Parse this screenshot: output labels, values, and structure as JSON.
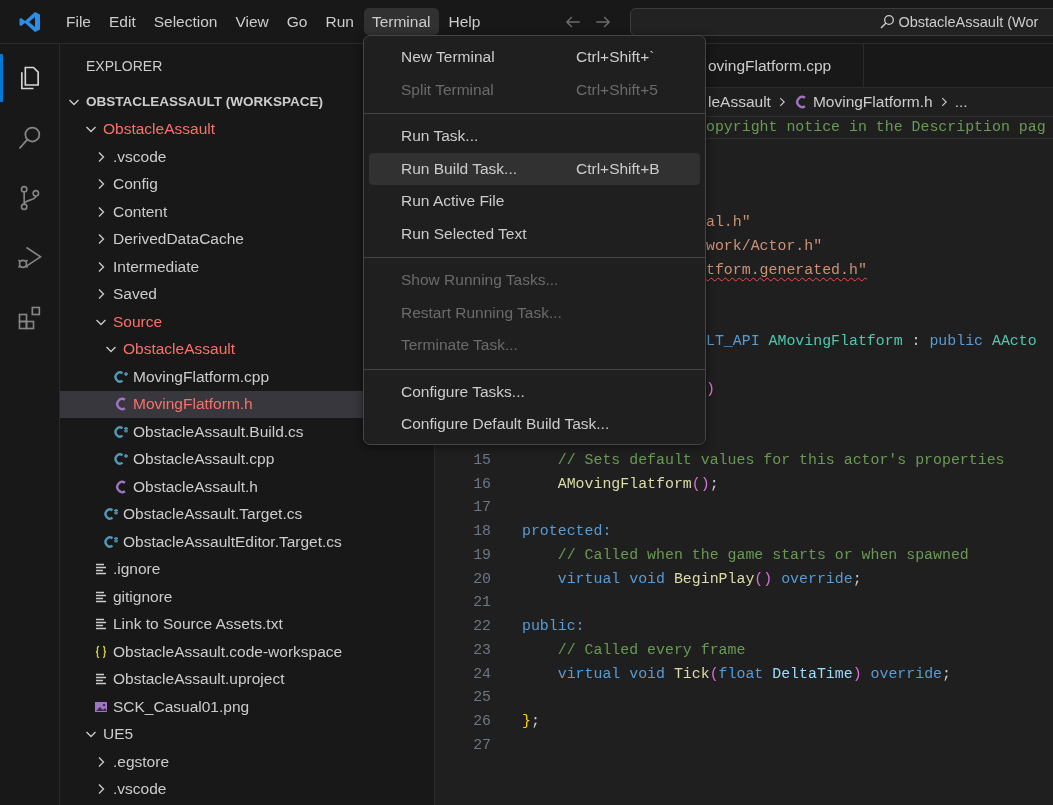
{
  "menubar": [
    {
      "label": "File",
      "selected": false
    },
    {
      "label": "Edit",
      "selected": false
    },
    {
      "label": "Selection",
      "selected": false
    },
    {
      "label": "View",
      "selected": false
    },
    {
      "label": "Go",
      "selected": false
    },
    {
      "label": "Run",
      "selected": false
    },
    {
      "label": "Terminal",
      "selected": true
    },
    {
      "label": "Help",
      "selected": false
    }
  ],
  "command_center": {
    "text": "ObstacleAssault (Wor"
  },
  "activity_bar": [
    {
      "kind": "explorer",
      "selected": true
    },
    {
      "kind": "search",
      "selected": false
    },
    {
      "kind": "source-control",
      "selected": false
    },
    {
      "kind": "run-debug",
      "selected": false
    },
    {
      "kind": "extensions",
      "selected": false
    }
  ],
  "sidebar": {
    "title": "EXPLORER",
    "tree": [
      {
        "label": "OBSTACLEASSAULT (WORKSPACE)",
        "kind": "root",
        "expanded": true,
        "selected": false,
        "error": false,
        "children": [
          {
            "label": "ObstacleAssault",
            "kind": "folder",
            "expanded": true,
            "selected": false,
            "error": true,
            "children": [
              {
                "label": ".vscode",
                "kind": "folder",
                "expanded": false,
                "selected": false,
                "error": false
              },
              {
                "label": "Config",
                "kind": "folder",
                "expanded": false,
                "selected": false,
                "error": false
              },
              {
                "label": "Content",
                "kind": "folder",
                "expanded": false,
                "selected": false,
                "error": false
              },
              {
                "label": "DerivedDataCache",
                "kind": "folder",
                "expanded": false,
                "selected": false,
                "error": false
              },
              {
                "label": "Intermediate",
                "kind": "folder",
                "expanded": false,
                "selected": false,
                "error": false
              },
              {
                "label": "Saved",
                "kind": "folder",
                "expanded": false,
                "selected": false,
                "error": false
              },
              {
                "label": "Source",
                "kind": "folder",
                "expanded": true,
                "selected": false,
                "error": true,
                "children": [
                  {
                    "label": "ObstacleAssault",
                    "kind": "folder",
                    "expanded": true,
                    "selected": false,
                    "error": true,
                    "children": [
                      {
                        "label": "MovingFlatform.cpp",
                        "kind": "cpp",
                        "selected": false,
                        "error": false
                      },
                      {
                        "label": "MovingFlatform.h",
                        "kind": "header",
                        "selected": true,
                        "error": true
                      },
                      {
                        "label": "ObstacleAssault.Build.cs",
                        "kind": "csharp",
                        "selected": false,
                        "error": false
                      },
                      {
                        "label": "ObstacleAssault.cpp",
                        "kind": "cpp",
                        "selected": false,
                        "error": false
                      },
                      {
                        "label": "ObstacleAssault.h",
                        "kind": "header",
                        "selected": false,
                        "error": false
                      }
                    ]
                  },
                  {
                    "label": "ObstacleAssault.Target.cs",
                    "kind": "csharp",
                    "selected": false,
                    "error": false
                  },
                  {
                    "label": "ObstacleAssaultEditor.Target.cs",
                    "kind": "csharp",
                    "selected": false,
                    "error": false
                  }
                ]
              },
              {
                "label": ".ignore",
                "kind": "text",
                "selected": false,
                "error": false
              },
              {
                "label": "gitignore",
                "kind": "text",
                "selected": false,
                "error": false
              },
              {
                "label": "Link to Source Assets.txt",
                "kind": "text",
                "selected": false,
                "error": false
              },
              {
                "label": "ObstacleAssault.code-workspace",
                "kind": "json",
                "selected": false,
                "error": false
              },
              {
                "label": "ObstacleAssault.uproject",
                "kind": "text",
                "selected": false,
                "error": false
              },
              {
                "label": "SCK_Casual01.png",
                "kind": "image",
                "selected": false,
                "error": false
              }
            ]
          },
          {
            "label": "UE5",
            "kind": "folder",
            "expanded": true,
            "selected": false,
            "error": false,
            "children": [
              {
                "label": ".egstore",
                "kind": "folder",
                "expanded": false,
                "selected": false,
                "error": false
              },
              {
                "label": ".vscode",
                "kind": "folder",
                "expanded": false,
                "selected": false,
                "error": false
              }
            ]
          }
        ]
      }
    ]
  },
  "editor": {
    "tab": "ovingFlatform.cpp",
    "breadcrumb": {
      "folder": "leAssault",
      "file": "MovingFlatform.h",
      "more": "..."
    },
    "lines": [
      {
        "kind": "fragment",
        "current": true,
        "tokens": [
          {
            "t": "opyright notice in the Description pag",
            "kind": "comment"
          }
        ]
      },
      {
        "kind": "blank"
      },
      {
        "kind": "blank"
      },
      {
        "kind": "blank"
      },
      {
        "kind": "fragment",
        "tokens": [
          {
            "t": "al.h\"",
            "kind": "string"
          }
        ]
      },
      {
        "kind": "fragment",
        "tokens": [
          {
            "t": "work/Actor.h\"",
            "kind": "string"
          }
        ]
      },
      {
        "kind": "fragment",
        "tokens": [
          {
            "t": "tform.generated.h\"",
            "kind": "string",
            "squiggle": true
          }
        ]
      },
      {
        "kind": "blank"
      },
      {
        "kind": "blank"
      },
      {
        "kind": "fragment",
        "tokens": [
          {
            "t": "LT_API ",
            "kind": "keyword"
          },
          {
            "t": "AMovingFlatform",
            "kind": "type"
          },
          {
            "t": " : ",
            "kind": "plain"
          },
          {
            "t": "public",
            "kind": "keyword"
          },
          {
            "t": " AActo",
            "kind": "type"
          }
        ]
      },
      {
        "kind": "blank"
      },
      {
        "kind": "fragment",
        "tokens": [
          {
            "t": ")",
            "kind": "paren"
          }
        ]
      },
      {
        "kind": "blank"
      },
      {
        "kind": "blank"
      },
      {
        "kind": "numbered",
        "number": "15",
        "tokens": [
          {
            "t": "    // Sets default values for this actor's properties",
            "kind": "comment"
          }
        ]
      },
      {
        "kind": "numbered",
        "number": "16",
        "tokens": [
          {
            "t": "    AMovingFlatform",
            "kind": "func"
          },
          {
            "t": "()",
            "kind": "paren"
          },
          {
            "t": ";",
            "kind": "plain"
          }
        ]
      },
      {
        "kind": "numbered",
        "number": "17"
      },
      {
        "kind": "numbered",
        "number": "18",
        "tokens": [
          {
            "t": "protected:",
            "kind": "keyword"
          }
        ]
      },
      {
        "kind": "numbered",
        "number": "19",
        "tokens": [
          {
            "t": "    // Called when the game starts or when spawned",
            "kind": "comment"
          }
        ]
      },
      {
        "kind": "numbered",
        "number": "20",
        "tokens": [
          {
            "t": "    virtual void ",
            "kind": "keyword"
          },
          {
            "t": "BeginPlay",
            "kind": "func"
          },
          {
            "t": "()",
            "kind": "paren"
          },
          {
            "t": " override",
            "kind": "keyword"
          },
          {
            "t": ";",
            "kind": "plain"
          }
        ]
      },
      {
        "kind": "numbered",
        "number": "21"
      },
      {
        "kind": "numbered",
        "number": "22",
        "tokens": [
          {
            "t": "public:",
            "kind": "keyword"
          }
        ]
      },
      {
        "kind": "numbered",
        "number": "23",
        "tokens": [
          {
            "t": "    // Called every frame",
            "kind": "comment"
          }
        ]
      },
      {
        "kind": "numbered",
        "number": "24",
        "tokens": [
          {
            "t": "    virtual void ",
            "kind": "keyword"
          },
          {
            "t": "Tick",
            "kind": "func"
          },
          {
            "t": "(",
            "kind": "paren"
          },
          {
            "t": "float ",
            "kind": "keyword"
          },
          {
            "t": "DeltaTime",
            "kind": "param"
          },
          {
            "t": ")",
            "kind": "paren"
          },
          {
            "t": " override",
            "kind": "keyword"
          },
          {
            "t": ";",
            "kind": "plain"
          }
        ]
      },
      {
        "kind": "numbered",
        "number": "25"
      },
      {
        "kind": "numbered",
        "number": "26",
        "tokens": [
          {
            "t": "}",
            "kind": "brace"
          },
          {
            "t": ";",
            "kind": "plain"
          }
        ]
      },
      {
        "kind": "numbered",
        "number": "27"
      }
    ]
  },
  "terminal_menu": {
    "groups": [
      [
        {
          "label": "New Terminal",
          "shortcut": "Ctrl+Shift+`",
          "disabled": false,
          "selected": false
        },
        {
          "label": "Split Terminal",
          "shortcut": "Ctrl+Shift+5",
          "disabled": true,
          "selected": false
        }
      ],
      [
        {
          "label": "Run Task...",
          "disabled": false,
          "selected": false
        },
        {
          "label": "Run Build Task...",
          "shortcut": "Ctrl+Shift+B",
          "disabled": false,
          "selected": true
        },
        {
          "label": "Run Active File",
          "disabled": false,
          "selected": false
        },
        {
          "label": "Run Selected Text",
          "disabled": false,
          "selected": false
        }
      ],
      [
        {
          "label": "Show Running Tasks...",
          "disabled": true,
          "selected": false
        },
        {
          "label": "Restart Running Task...",
          "disabled": true,
          "selected": false
        },
        {
          "label": "Terminate Task...",
          "disabled": true,
          "selected": false
        }
      ],
      [
        {
          "label": "Configure Tasks...",
          "disabled": false,
          "selected": false
        },
        {
          "label": "Configure Default Build Task...",
          "disabled": false,
          "selected": false
        }
      ]
    ]
  }
}
